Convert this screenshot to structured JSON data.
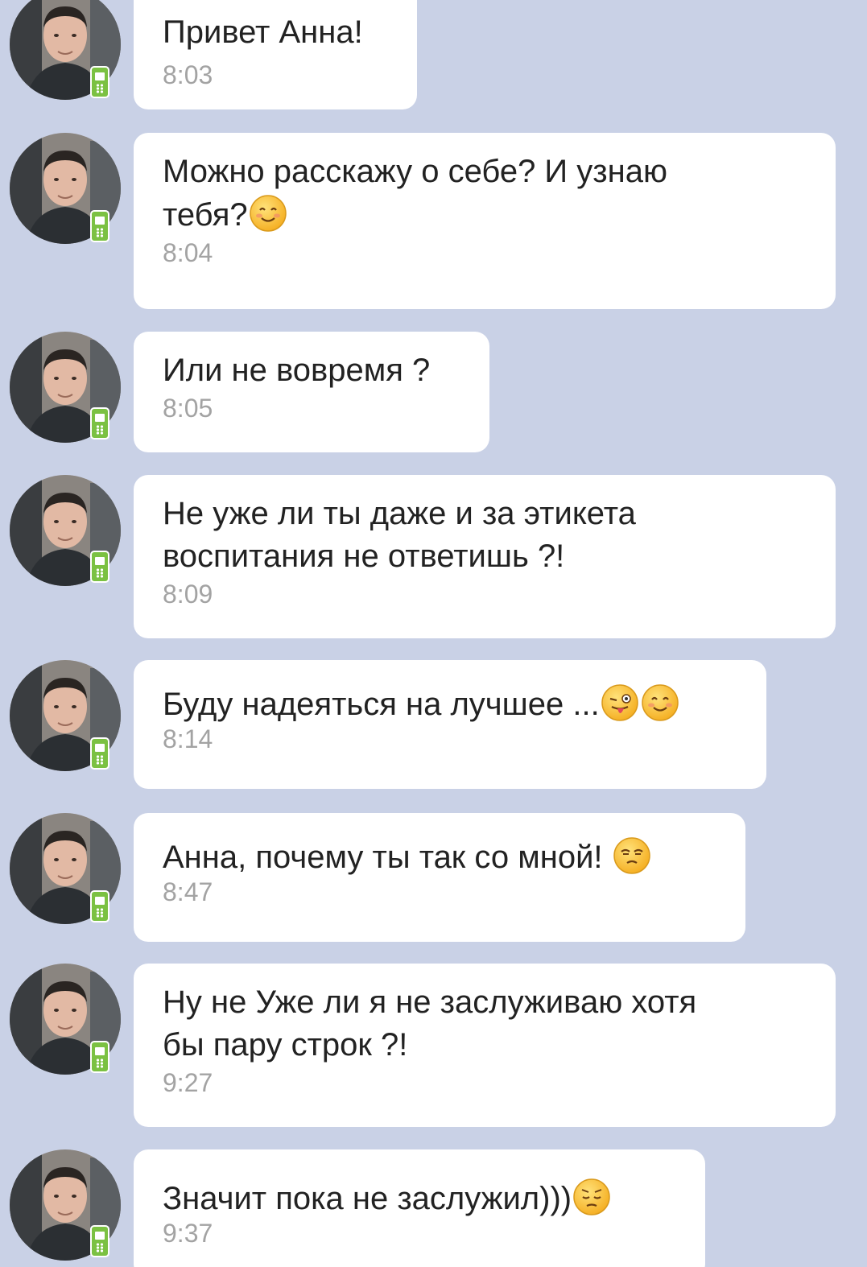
{
  "messages": [
    {
      "text": "Привет Анна!",
      "time": "8:03",
      "emojis": []
    },
    {
      "text": "Можно расскажу о себе? И узнаю\nтебя?",
      "time": "8:04",
      "emojis": [
        "smile-emoji"
      ]
    },
    {
      "text": "Или не вовремя ?",
      "time": "8:05",
      "emojis": []
    },
    {
      "text": "Не уже ли ты даже и за этикета\nвоспитания не ответишь ?!",
      "time": "8:09",
      "emojis": []
    },
    {
      "text": "Буду надеяться на лучшее ...",
      "time": "8:14",
      "emojis": [
        "wink-tongue-emoji",
        "smile-emoji"
      ]
    },
    {
      "text": "Анна, почему ты так со мной!",
      "time": "8:47",
      "emojis": [
        "unamused-emoji"
      ]
    },
    {
      "text": "Ну не Уже ли я не заслуживаю хотя\nбы пару строк ?!",
      "time": "9:27",
      "emojis": []
    },
    {
      "text": "Значит пока не заслужил)))",
      "time": "9:37",
      "emojis": [
        "pensive-emoji"
      ]
    }
  ],
  "colors": {
    "background": "#c9d1e6",
    "bubble": "#ffffff",
    "text": "#222222",
    "time": "#a3a3a3",
    "phone_badge": "#7bc142"
  },
  "icons": {
    "avatar": "avatar",
    "status": "mobile-phone-icon"
  }
}
